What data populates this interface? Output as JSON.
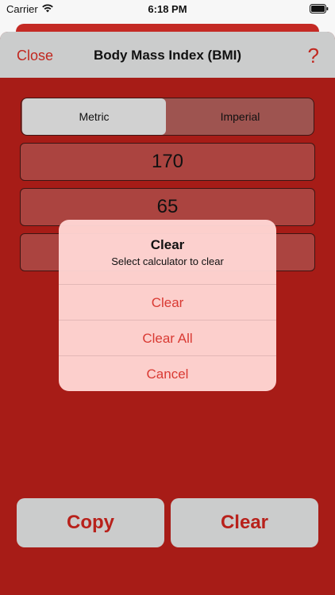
{
  "status_bar": {
    "carrier": "Carrier",
    "time": "6:18 PM"
  },
  "nav": {
    "close_label": "Close",
    "title": "Body Mass Index (BMI)",
    "help_label": "?"
  },
  "segments": {
    "metric_label": "Metric",
    "imperial_label": "Imperial",
    "selected": "Metric"
  },
  "fields": {
    "height_value": "170",
    "weight_value": "65",
    "result_value": ""
  },
  "alert": {
    "title": "Clear",
    "message": "Select calculator to clear",
    "actions": [
      "Clear",
      "Clear All",
      "Cancel"
    ]
  },
  "buttons": {
    "copy_label": "Copy",
    "clear_label": "Clear"
  },
  "colors": {
    "accent": "#c1271f",
    "sheet_background": "#a71c17",
    "nav_background": "#cbcccc",
    "alert_background": "#ffd6d4"
  },
  "icons": {
    "wifi": "wifi-icon",
    "battery": "battery-icon"
  }
}
